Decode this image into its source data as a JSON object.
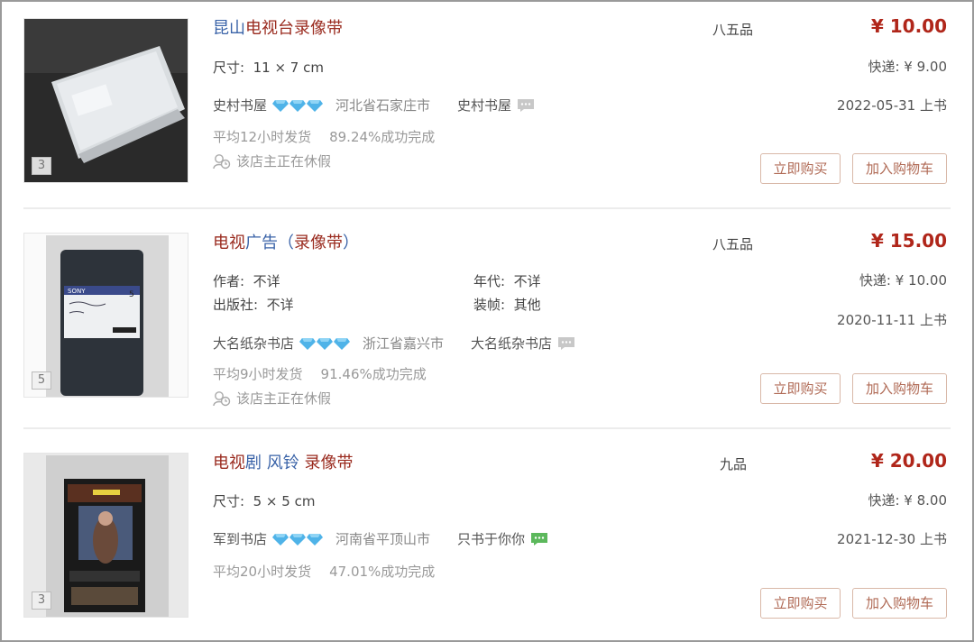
{
  "listings": [
    {
      "image_count": "3",
      "title_parts": [
        {
          "text": "昆山",
          "tone": "blue"
        },
        {
          "text": "电视台录像带",
          "tone": "red"
        }
      ],
      "condition": "八五品",
      "price": "¥ 10.00",
      "attrs": [
        {
          "label": "尺寸:",
          "value": "11 × 7 cm"
        }
      ],
      "shipping": "快递: ¥ 9.00",
      "shop": {
        "name": "史村书屋",
        "diamonds": 3,
        "region": "河北省石家庄市",
        "seller": "史村书屋",
        "chat_color": "#c8c8c8"
      },
      "stats": {
        "ship_time": "平均12小时发货",
        "success": "89.24%成功完成"
      },
      "vacation": "该店主正在休假",
      "date": "2022-05-31 上书",
      "buy_label": "立即购买",
      "cart_label": "加入购物车"
    },
    {
      "image_count": "5",
      "title_parts": [
        {
          "text": "电视",
          "tone": "red"
        },
        {
          "text": "广告（",
          "tone": "blue"
        },
        {
          "text": "录像带",
          "tone": "red"
        },
        {
          "text": "）",
          "tone": "blue"
        }
      ],
      "condition": "八五品",
      "price": "¥ 15.00",
      "attrs": [
        {
          "label": "作者:",
          "value": "不详"
        },
        {
          "label": "年代:",
          "value": "不详"
        },
        {
          "label": "出版社:",
          "value": "不详"
        },
        {
          "label": "装帧:",
          "value": "其他"
        }
      ],
      "shipping": "快递: ¥ 10.00",
      "shop": {
        "name": "大名纸杂书店",
        "diamonds": 3,
        "region": "浙江省嘉兴市",
        "seller": "大名纸杂书店",
        "chat_color": "#c8c8c8"
      },
      "stats": {
        "ship_time": "平均9小时发货",
        "success": "91.46%成功完成"
      },
      "vacation": "该店主正在休假",
      "date": "2020-11-11 上书",
      "buy_label": "立即购买",
      "cart_label": "加入购物车"
    },
    {
      "image_count": "3",
      "title_parts": [
        {
          "text": "电视",
          "tone": "red"
        },
        {
          "text": "剧 风铃 ",
          "tone": "blue"
        },
        {
          "text": "录像带",
          "tone": "red"
        }
      ],
      "condition": "九品",
      "price": "¥ 20.00",
      "attrs": [
        {
          "label": "尺寸:",
          "value": "5 × 5 cm"
        }
      ],
      "shipping": "快递: ¥ 8.00",
      "shop": {
        "name": "军到书店",
        "diamonds": 3,
        "region": "河南省平顶山市",
        "seller": "只书于你你",
        "chat_color": "#5cb85c"
      },
      "stats": {
        "ship_time": "平均20小时发货",
        "success": "47.01%成功完成"
      },
      "vacation": "",
      "date": "2021-12-30 上书",
      "buy_label": "立即购买",
      "cart_label": "加入购物车"
    }
  ],
  "colors": {
    "price": "#b0261a",
    "title_blue": "#3a63a8",
    "title_red": "#9a2b1f",
    "diamond": "#4fb3e8",
    "button_text": "#b06a55"
  }
}
